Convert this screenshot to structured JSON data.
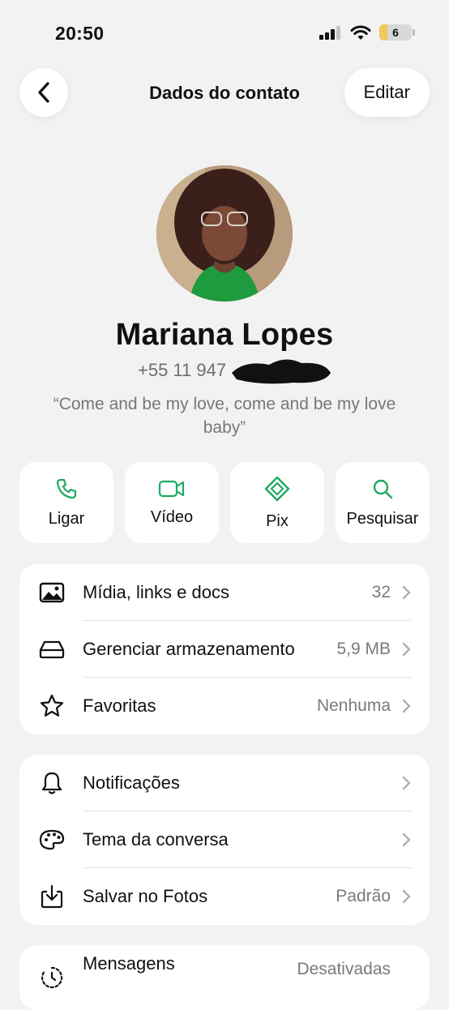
{
  "status_bar": {
    "time": "20:50",
    "battery_level": "6",
    "signal_icon": "cellular-signal-icon",
    "wifi_icon": "wifi-icon"
  },
  "nav": {
    "title": "Dados do contato",
    "edit_label": "Editar",
    "back_icon": "chevron-left-icon"
  },
  "contact": {
    "name": "Mariana Lopes",
    "phone": "+55 11 947",
    "about": "“Come and be my love, come and be my love baby”"
  },
  "actions": [
    {
      "label": "Ligar",
      "icon": "phone-icon"
    },
    {
      "label": "Vídeo",
      "icon": "video-icon"
    },
    {
      "label": "Pix",
      "icon": "pix-icon"
    },
    {
      "label": "Pesquisar",
      "icon": "search-icon"
    }
  ],
  "media_card": [
    {
      "label": "Mídia, links e docs",
      "value": "32",
      "icon": "image-icon"
    },
    {
      "label": "Gerenciar armazenamento",
      "value": "5,9 MB",
      "icon": "storage-icon"
    },
    {
      "label": "Favoritas",
      "value": "Nenhuma",
      "icon": "star-icon"
    }
  ],
  "settings_card": [
    {
      "label": "Notificações",
      "value": "",
      "icon": "bell-icon"
    },
    {
      "label": "Tema da conversa",
      "value": "",
      "icon": "palette-icon"
    },
    {
      "label": "Salvar no Fotos",
      "value": "Padrão",
      "icon": "save-download-icon"
    }
  ],
  "bottom_card": {
    "label": "Mensagens",
    "value": "Desativadas",
    "icon": "timer-icon"
  },
  "colors": {
    "accent": "#1DAA61",
    "background": "#f2f2f2",
    "card": "#ffffff"
  }
}
